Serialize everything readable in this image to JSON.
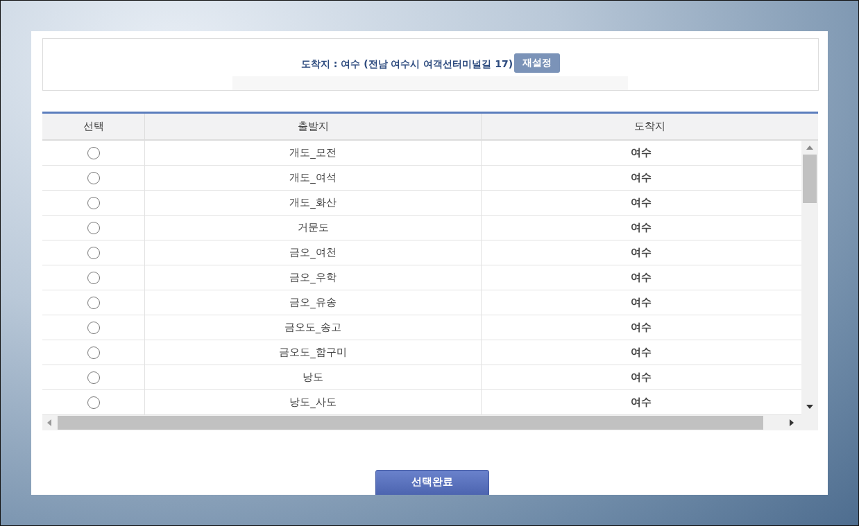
{
  "destination": {
    "label": "도착지 : 여수 (전남 여수시 여객선터미널길 17)",
    "reset_button": "재설정"
  },
  "table": {
    "columns": [
      "선택",
      "출발지",
      "도착지"
    ],
    "rows": [
      {
        "selected": false,
        "departure": "개도_모전",
        "arrival": "여수"
      },
      {
        "selected": false,
        "departure": "개도_여석",
        "arrival": "여수"
      },
      {
        "selected": false,
        "departure": "개도_화산",
        "arrival": "여수"
      },
      {
        "selected": false,
        "departure": "거문도",
        "arrival": "여수"
      },
      {
        "selected": false,
        "departure": "금오_여천",
        "arrival": "여수"
      },
      {
        "selected": false,
        "departure": "금오_우학",
        "arrival": "여수"
      },
      {
        "selected": false,
        "departure": "금오_유송",
        "arrival": "여수"
      },
      {
        "selected": false,
        "departure": "금오도_송고",
        "arrival": "여수"
      },
      {
        "selected": false,
        "departure": "금오도_함구미",
        "arrival": "여수"
      },
      {
        "selected": false,
        "departure": "낭도",
        "arrival": "여수"
      },
      {
        "selected": false,
        "departure": "낭도_사도",
        "arrival": "여수"
      }
    ]
  },
  "confirm_button": "선택완료"
}
